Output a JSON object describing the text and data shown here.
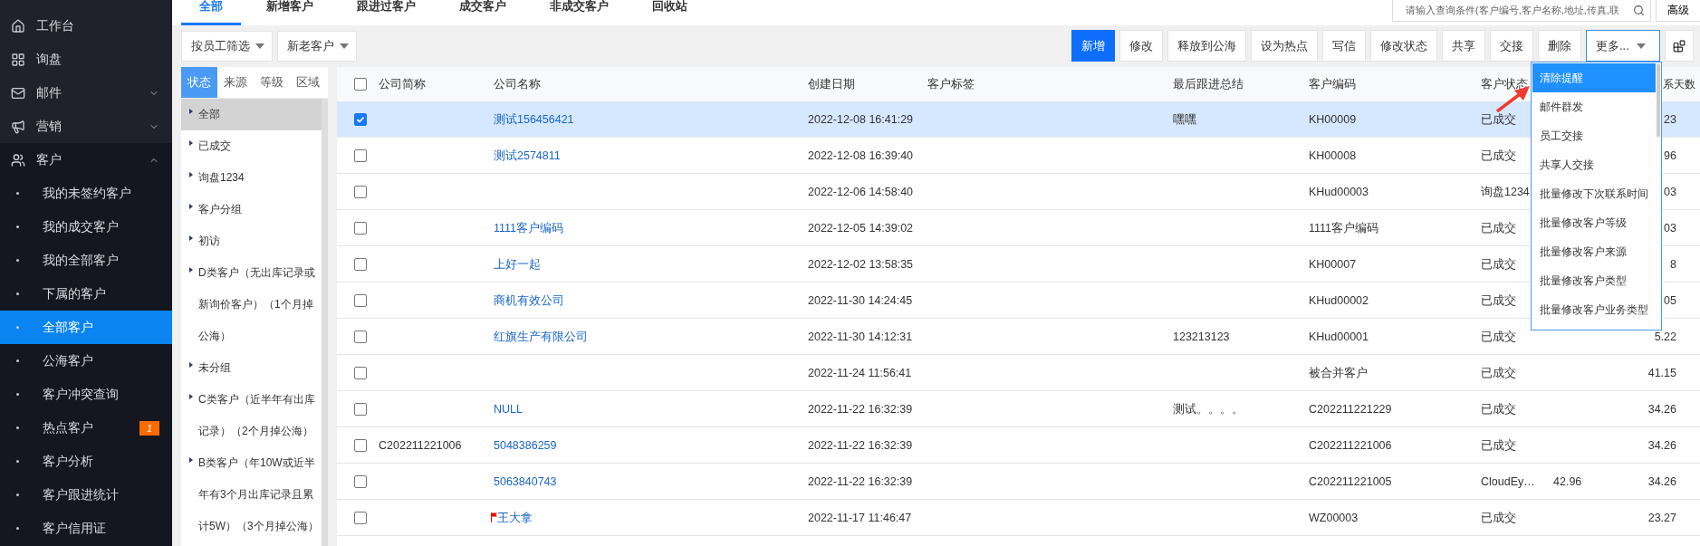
{
  "sidebar": {
    "items": [
      {
        "label": "工作台"
      },
      {
        "label": "询盘"
      },
      {
        "label": "邮件",
        "expanded": false
      },
      {
        "label": "营销",
        "expanded": false
      },
      {
        "label": "客户",
        "expanded": true,
        "children": [
          {
            "label": "我的未签约客户",
            "selected": false
          },
          {
            "label": "我的成交客户",
            "selected": false
          },
          {
            "label": "我的全部客户",
            "selected": false
          },
          {
            "label": "下属的客户",
            "selected": false
          },
          {
            "label": "全部客户",
            "selected": true
          },
          {
            "label": "公海客户",
            "selected": false
          },
          {
            "label": "客户冲突查询",
            "selected": false
          },
          {
            "label": "热点客户",
            "selected": false,
            "badge": "1"
          },
          {
            "label": "客户分析",
            "selected": false
          },
          {
            "label": "客户跟进统计",
            "selected": false
          },
          {
            "label": "客户信用证",
            "selected": false
          }
        ]
      }
    ]
  },
  "tabs": [
    {
      "label": "全部",
      "selected": true
    },
    {
      "label": "新增客户",
      "selected": false
    },
    {
      "label": "跟进过客户",
      "selected": false
    },
    {
      "label": "成交客户",
      "selected": false
    },
    {
      "label": "非成交客户",
      "selected": false
    },
    {
      "label": "回收站",
      "selected": false
    }
  ],
  "search": {
    "placeholder": "请输入查询条件(客户编号,客户名称,地址,传真,联"
  },
  "advanced_button": "高级",
  "filters": [
    {
      "label": "按员工筛选"
    },
    {
      "label": "新老客户"
    }
  ],
  "toolbar": [
    {
      "label": "新增",
      "kind": "primary"
    },
    {
      "label": "修改",
      "kind": "default"
    },
    {
      "label": "释放到公海",
      "kind": "default"
    },
    {
      "label": "设为热点",
      "kind": "default"
    },
    {
      "label": "写信",
      "kind": "default"
    },
    {
      "label": "修改状态",
      "kind": "default"
    },
    {
      "label": "共享",
      "kind": "default"
    },
    {
      "label": "交接",
      "kind": "default"
    },
    {
      "label": "删除",
      "kind": "default"
    },
    {
      "label": "更多...",
      "kind": "dropdown"
    },
    {
      "kind": "icon"
    }
  ],
  "filter_panel": {
    "tabs": [
      {
        "label": "状态",
        "selected": true
      },
      {
        "label": "来源",
        "selected": false
      },
      {
        "label": "等级",
        "selected": false
      },
      {
        "label": "区域",
        "selected": false
      }
    ],
    "items": [
      {
        "label": "全部",
        "selected": true
      },
      {
        "label": "已成交",
        "selected": false
      },
      {
        "label": "询盘1234",
        "selected": false
      },
      {
        "label": "客户分组",
        "selected": false
      },
      {
        "label": "初访",
        "selected": false
      },
      {
        "label": "D类客户（无出库记录或新询价客户）（1个月掉公海）",
        "selected": false
      },
      {
        "label": "未分组",
        "selected": false
      },
      {
        "label": "C类客户（近半年有出库记录）（2个月掉公海）",
        "selected": false
      },
      {
        "label": "B类客户（年10W或近半年有3个月出库记录且累计5W）（3个月掉公海）",
        "selected": false
      }
    ]
  },
  "table": {
    "header_checked": false,
    "columns": [
      "公司简称",
      "公司名称",
      "创建日期",
      "客户标签",
      "最后跟进总结",
      "客户编码",
      "客户状态",
      null,
      "系天数"
    ],
    "rows": [
      {
        "selected": true,
        "flagged": false,
        "cells": [
          null,
          "测试156456421",
          "2022-12-08 16:41:29",
          null,
          "嘿嘿",
          "KH00009",
          "已成交",
          null,
          "23"
        ]
      },
      {
        "selected": false,
        "flagged": false,
        "cells": [
          null,
          "测试2574811",
          "2022-12-08 16:39:40",
          null,
          null,
          "KH00008",
          "已成交",
          null,
          "96"
        ]
      },
      {
        "selected": false,
        "flagged": false,
        "cells": [
          null,
          null,
          "2022-12-06 14:58:40",
          null,
          null,
          "KHud00003",
          "询盘1234",
          null,
          "03"
        ]
      },
      {
        "selected": false,
        "flagged": false,
        "cells": [
          null,
          "1111客户编码",
          "2022-12-05 14:39:02",
          null,
          null,
          "1111客户编码",
          "已成交",
          null,
          "03"
        ]
      },
      {
        "selected": false,
        "flagged": false,
        "cells": [
          null,
          "上好一起",
          "2022-12-02 13:58:35",
          null,
          null,
          "KH00007",
          "已成交",
          null,
          "8"
        ]
      },
      {
        "selected": false,
        "flagged": false,
        "cells": [
          null,
          "商机有效公司",
          "2022-11-30 14:24:45",
          null,
          null,
          "KHud00002",
          "已成交",
          null,
          "05"
        ]
      },
      {
        "selected": false,
        "flagged": false,
        "cells": [
          null,
          "红旗生产有限公司",
          "2022-11-30 14:12:31",
          null,
          "123213123",
          "KHud00001",
          "已成交",
          null,
          "5.22"
        ]
      },
      {
        "selected": false,
        "flagged": false,
        "cells": [
          null,
          null,
          "2022-11-24 11:56:41",
          null,
          null,
          "被合并客户",
          "已成交",
          null,
          "41.15"
        ]
      },
      {
        "selected": false,
        "flagged": false,
        "cells": [
          null,
          "NULL",
          "2022-11-22 16:32:39",
          null,
          "测试。。。。",
          "C202211221229",
          "已成交",
          null,
          "34.26"
        ]
      },
      {
        "selected": false,
        "flagged": false,
        "cells": [
          "C202211221006",
          "5048386259",
          "2022-11-22 16:32:39",
          null,
          null,
          "C202211221006",
          "已成交",
          null,
          "34.26"
        ]
      },
      {
        "selected": false,
        "flagged": false,
        "cells": [
          null,
          "5063840743",
          "2022-11-22 16:32:39",
          null,
          null,
          "C202211221005",
          "CloudEy…",
          "42.96",
          "34.26"
        ]
      },
      {
        "selected": false,
        "flagged": true,
        "cells": [
          null,
          "王大拿",
          "2022-11-17 11:46:47",
          null,
          null,
          "WZ00003",
          "已成交",
          null,
          "23.27"
        ]
      }
    ]
  },
  "more_menu": {
    "items": [
      {
        "label": "清除提醒",
        "selected": true
      },
      {
        "label": "邮件群发",
        "selected": false
      },
      {
        "label": "员工交接",
        "selected": false
      },
      {
        "label": "共享人交接",
        "selected": false
      },
      {
        "label": "批量修改下次联系时间",
        "selected": false
      },
      {
        "label": "批量修改客户等级",
        "selected": false
      },
      {
        "label": "批量修改客户来源",
        "selected": false
      },
      {
        "label": "批量修改客户类型",
        "selected": false
      },
      {
        "label": "批量修改客户业务类型",
        "selected": false
      }
    ]
  }
}
